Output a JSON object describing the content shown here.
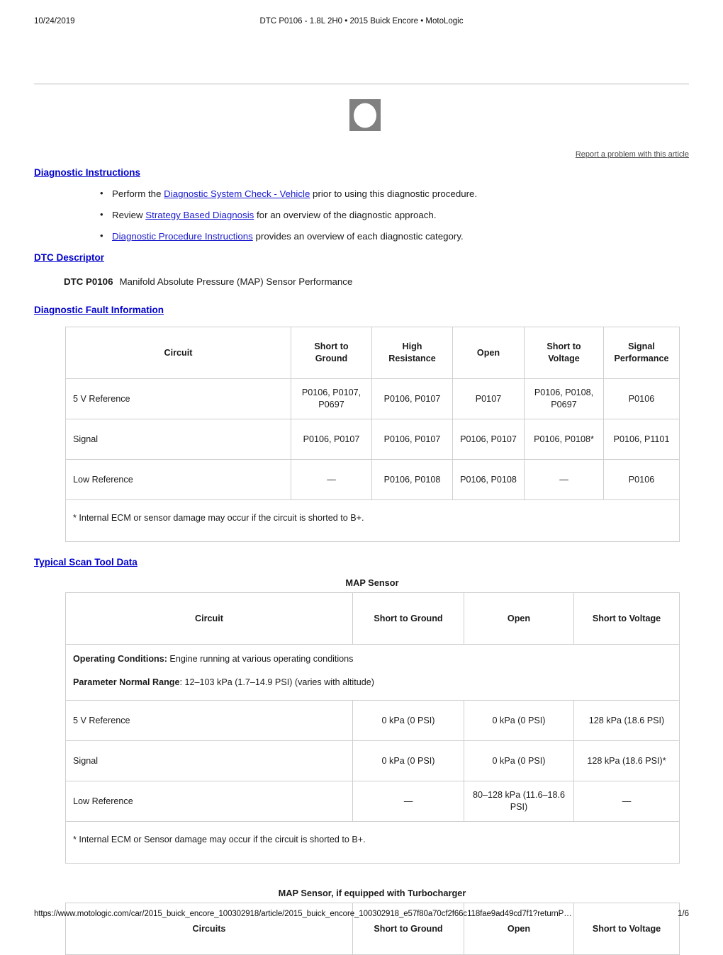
{
  "print_header": {
    "date": "10/24/2019",
    "title": "DTC P0106 - 1.8L 2H0 • 2015 Buick Encore • MotoLogic"
  },
  "print_footer": {
    "url": "https://www.motologic.com/car/2015_buick_encore_100302918/article/2015_buick_encore_100302918_e57f80a70cf2f66c118fae9ad49cd7f1?returnP…",
    "page": "1/6"
  },
  "article": {
    "broken_image_alt": "broken-image",
    "report_link": "Report a problem with this article",
    "diagnostic_instructions": {
      "heading": "Diagnostic Instructions",
      "bullets": [
        {
          "pre": "Perform the ",
          "link": "Diagnostic System Check - Vehicle",
          "post": " prior to using this diagnostic procedure."
        },
        {
          "pre": "Review ",
          "link": "Strategy Based Diagnosis",
          "post": " for an overview of the diagnostic approach."
        },
        {
          "pre": "",
          "link": "Diagnostic Procedure Instructions",
          "post": " provides an overview of each diagnostic category."
        }
      ]
    },
    "dtc_descriptor": {
      "heading": "DTC Descriptor",
      "code": "DTC P0106",
      "description": "Manifold Absolute Pressure (MAP) Sensor Performance"
    },
    "fault_information": {
      "heading": "Diagnostic Fault Information",
      "headers": [
        "Circuit",
        "Short to Ground",
        "High Resistance",
        "Open",
        "Short to Voltage",
        "Signal Performance"
      ],
      "rows": [
        [
          "5 V Reference",
          "P0106, P0107, P0697",
          "P0106, P0107",
          "P0107",
          "P0106, P0108, P0697",
          "P0106"
        ],
        [
          "Signal",
          "P0106, P0107",
          "P0106, P0107",
          "P0106, P0107",
          "P0106, P0108*",
          "P0106, P1101"
        ],
        [
          "Low Reference",
          "—",
          "P0106, P0108",
          "P0106, P0108",
          "—",
          "P0106"
        ]
      ],
      "footnote": "* Internal ECM or sensor damage may occur if the circuit is shorted to B+."
    },
    "scan_tool_data": {
      "heading": "Typical Scan Tool Data",
      "table1": {
        "caption": "MAP Sensor",
        "headers": [
          "Circuit",
          "Short to Ground",
          "Open",
          "Short to Voltage"
        ],
        "conditions": [
          {
            "label": "Operating Conditions:",
            "value": " Engine running at various operating conditions"
          },
          {
            "label": "Parameter Normal Range",
            "value": ": 12–103 kPa (1.7–14.9 PSI) (varies with altitude)"
          }
        ],
        "rows": [
          [
            "5 V Reference",
            "0 kPa (0 PSI)",
            "0 kPa (0 PSI)",
            "128 kPa (18.6 PSI)"
          ],
          [
            "Signal",
            "0 kPa (0 PSI)",
            "0 kPa (0 PSI)",
            "128 kPa (18.6 PSI)*"
          ],
          [
            "Low Reference",
            "—",
            "80–128 kPa (11.6–18.6 PSI)",
            "—"
          ]
        ],
        "footnote": "* Internal ECM or Sensor damage may occur if the circuit is shorted to B+."
      },
      "table2": {
        "caption": "MAP Sensor, if equipped with Turbocharger",
        "headers": [
          "Circuits",
          "Short to Ground",
          "Open",
          "Short to Voltage"
        ]
      }
    }
  }
}
